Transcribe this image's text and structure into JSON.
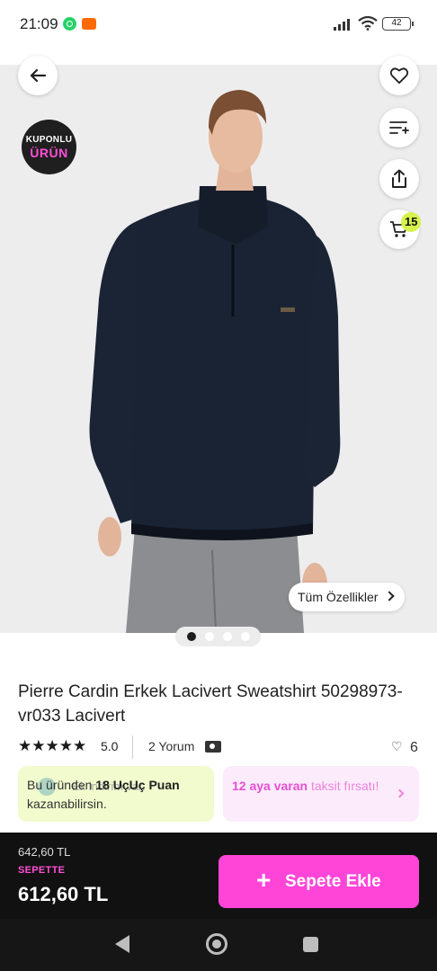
{
  "status_bar": {
    "time": "21:09",
    "battery": "42"
  },
  "product_image": {
    "coupon_badge": {
      "line1": "KUPONLU",
      "line2": "ÜRÜN"
    },
    "all_features_label": "Tüm Özellikler",
    "cart_count": "15",
    "carousel": {
      "count": 4,
      "active_index": 0
    }
  },
  "product": {
    "title": "Pierre Cardin Erkek Lacivert Sweatshirt 50298973-vr033 Lacivert",
    "rating_stars": "★★★★★",
    "rating_value": "5.0",
    "review_count": "2 Yorum",
    "like_count": "6"
  },
  "promos": {
    "points": {
      "prefix": "Bu üründen",
      "highlight": "18 UçUç Puan",
      "suffix": "kazanabilirsin.",
      "ghost_text": "Ek indirim var."
    },
    "installment": {
      "highlight": "12 aya varan",
      "text_after": "taksit fırsatı!"
    }
  },
  "bottom_bar": {
    "old_price": "642,60 TL",
    "basket_label": "SEPETTE",
    "new_price": "612,60 TL",
    "add_to_cart_plus": "+",
    "add_to_cart_label": "Sepete Ekle"
  },
  "colors": {
    "accent": "#ff45d8",
    "badge": "#d6f24b",
    "points_bg": "#f1fbcd",
    "installment_bg": "#fcecfb"
  }
}
